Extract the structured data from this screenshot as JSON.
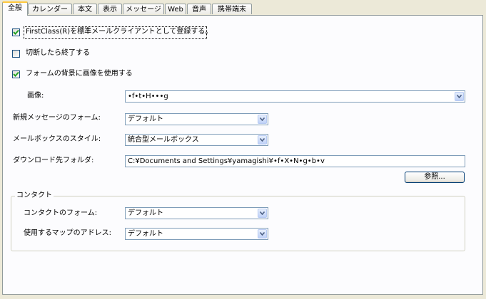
{
  "tabs": [
    "全般",
    "カレンダー",
    "本文",
    "表示",
    "メッセージ",
    "Web",
    "音声",
    "携帯端末"
  ],
  "checkboxes": [
    {
      "label": "FirstClass(R)を標準メールクライアントとして登録する。",
      "checked": true
    },
    {
      "label": "切断したら終了する",
      "checked": false
    },
    {
      "label": "フォームの背景に画像を使用する",
      "checked": true
    }
  ],
  "fields": {
    "image": {
      "label": "画像:",
      "value": "•f•t•H•••g"
    },
    "new_message_form": {
      "label": "新規メッセージのフォーム:",
      "value": "デフォルト"
    },
    "mailbox_style": {
      "label": "メールボックスのスタイル:",
      "value": "統合型メールボックス"
    },
    "download_folder": {
      "label": "ダウンロード先フォルダ:",
      "value": "C:¥Documents and Settings¥yamagishi¥•f•X•N•g•b•v"
    },
    "browse_button": "参照..."
  },
  "contact_group": {
    "title": "コンタクト",
    "contact_form": {
      "label": "コンタクトのフォーム:",
      "value": "デフォルト"
    },
    "map_address": {
      "label": "使用するマップのアドレス:",
      "value": "デフォルト"
    }
  },
  "colors": {
    "accent_tab": "#ffc83c",
    "check": "#21a121",
    "border": "#7f9db9"
  }
}
